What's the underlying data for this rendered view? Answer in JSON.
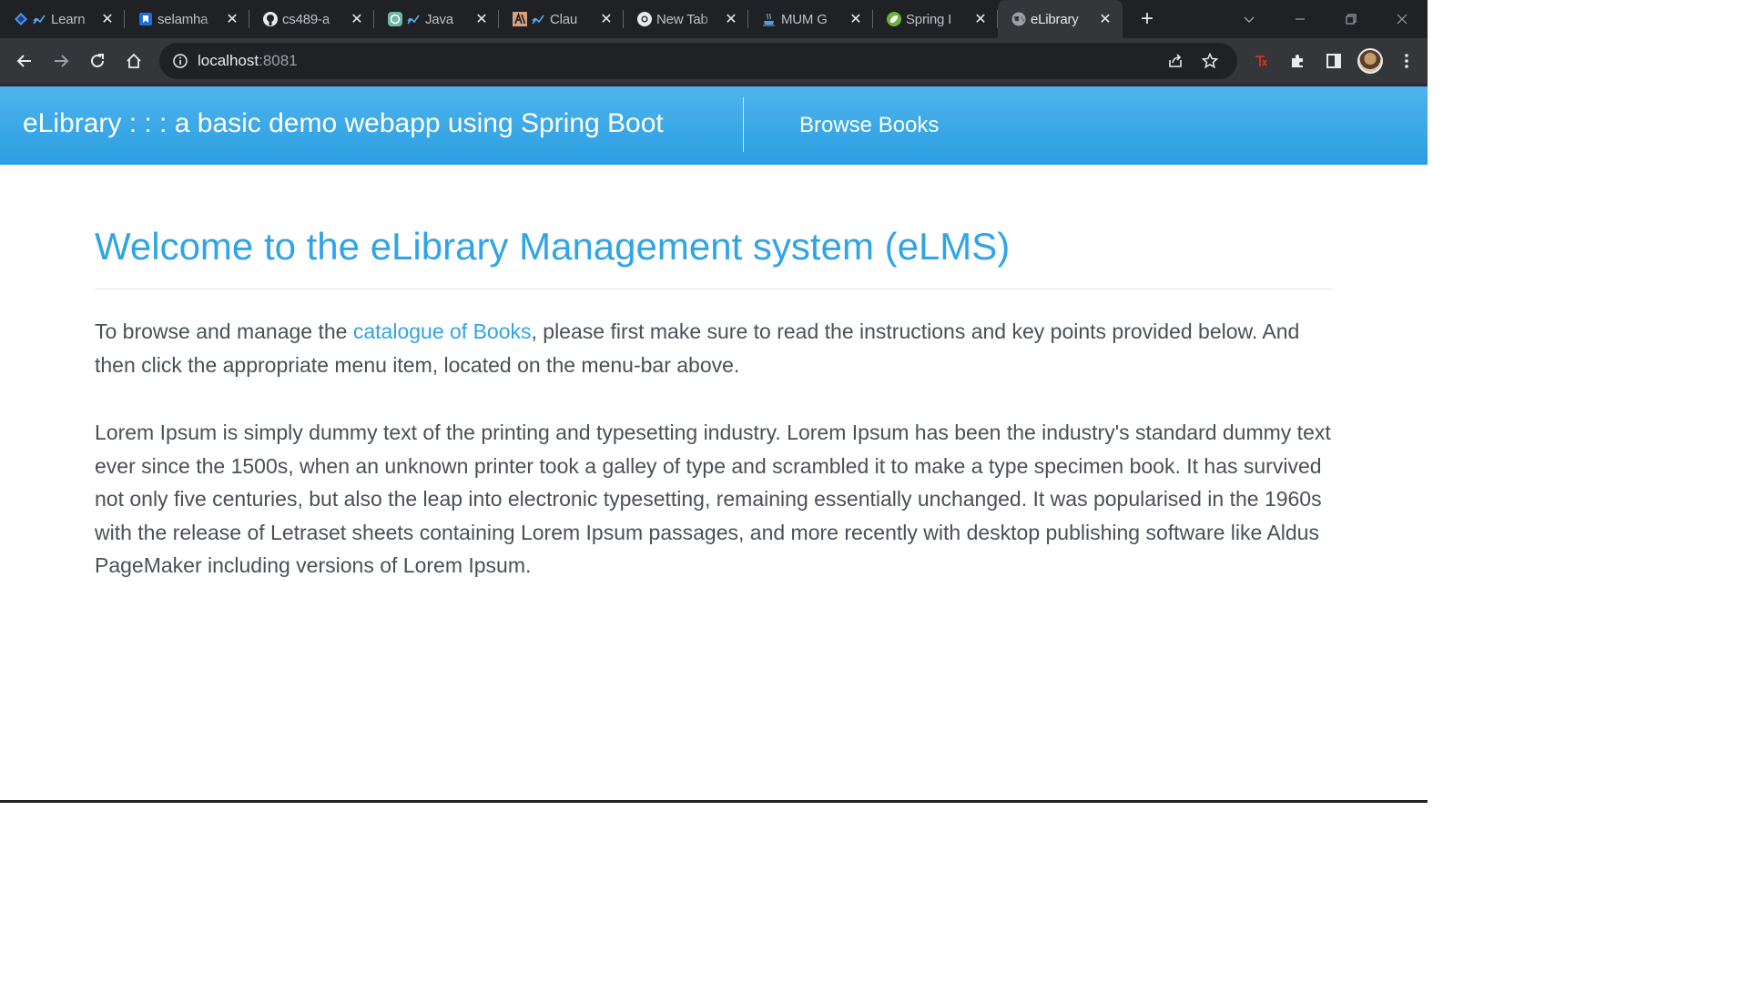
{
  "browser": {
    "tabs": [
      {
        "title": "Learn",
        "favicon": "learn-icon",
        "loading_icon": true
      },
      {
        "title": "selamha",
        "favicon": "bookmark-icon",
        "loading_icon": false
      },
      {
        "title": "cs489-a",
        "favicon": "github-icon",
        "loading_icon": false
      },
      {
        "title": "Java",
        "favicon": "chatgpt-icon",
        "loading_icon": true
      },
      {
        "title": "Clau",
        "favicon": "anthropic-icon",
        "loading_icon": true
      },
      {
        "title": "New Tab",
        "favicon": "chrome-icon",
        "loading_icon": false
      },
      {
        "title": "MUM G",
        "favicon": "java-cup-icon",
        "loading_icon": false
      },
      {
        "title": "Spring I",
        "favicon": "spring-icon",
        "loading_icon": false
      },
      {
        "title": "eLibrary",
        "favicon": "globe-icon",
        "loading_icon": false,
        "active": true
      }
    ],
    "address": {
      "host": "localhost",
      "port": ":8081"
    },
    "colors": {
      "tabstrip": "#202124",
      "toolbar": "#35363a",
      "omnibox": "#202124"
    }
  },
  "site": {
    "brand": "eLibrary : : : a basic demo webapp using Spring Boot",
    "nav_link": "Browse Books",
    "colors": {
      "navbar": "#2a9fe2",
      "heading": "#2fa4e7",
      "text": "#495057"
    }
  },
  "main": {
    "heading": "Welcome to the eLibrary Management system (eLMS)",
    "intro_before": "To browse and manage the ",
    "intro_link": "catalogue of Books",
    "intro_after": ", please first make sure to read the instructions and key points provided below. And then click the appropriate menu item, located on the menu-bar above.",
    "lorem": "Lorem Ipsum is simply dummy text of the printing and typesetting industry. Lorem Ipsum has been the industry's standard dummy text ever since the 1500s, when an unknown printer took a galley of type and scrambled it to make a type specimen book. It has survived not only five centuries, but also the leap into electronic typesetting, remaining essentially unchanged. It was popularised in the 1960s with the release of Letraset sheets containing Lorem Ipsum passages, and more recently with desktop publishing software like Aldus PageMaker including versions of Lorem Ipsum."
  }
}
